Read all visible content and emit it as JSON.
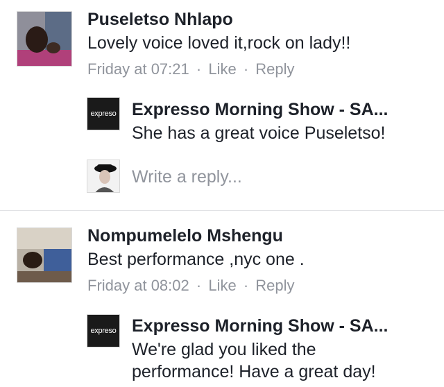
{
  "comments": [
    {
      "author": "Puseletso Nhlapo",
      "text": "Lovely voice loved it,rock on lady!!",
      "time": "Friday at 07:21",
      "like_label": "Like",
      "reply_label": "Reply",
      "avatar_icon": "user-photo-avatar",
      "reply": {
        "author": "Expresso Morning Show - SA...",
        "lines": [
          "She has a great voice Puseletso!"
        ],
        "logo_text": "expreso"
      }
    },
    {
      "author": "Nompumelelo Mshengu",
      "text": "Best performance ,nyc one .",
      "time": "Friday at 08:02",
      "like_label": "Like",
      "reply_label": "Reply",
      "avatar_icon": "user-photo-avatar",
      "reply": {
        "author": "Expresso Morning Show - SA...",
        "lines": [
          "We're glad you liked the",
          "performance! Have a great day!"
        ],
        "logo_text": "expreso"
      }
    }
  ],
  "write_reply": {
    "placeholder": "Write a reply..."
  },
  "separator": "·"
}
